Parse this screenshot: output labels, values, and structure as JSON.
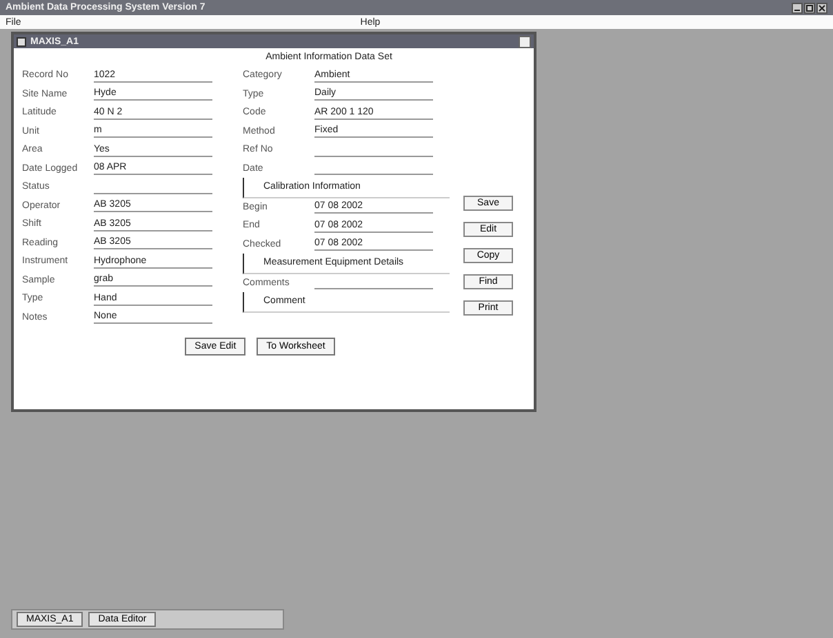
{
  "window": {
    "title": "Ambient Data Processing System Version 7"
  },
  "menu": [
    {
      "label": "File"
    },
    {
      "label": "Help"
    }
  ],
  "form": {
    "title": "MAXIS_A1",
    "heading": "Ambient Information Data Set",
    "left_fields": [
      {
        "label": "Record No",
        "value": "1022"
      },
      {
        "label": "Site Name",
        "value": "Hyde"
      },
      {
        "label": "Latitude",
        "value": "40 N 2"
      },
      {
        "label": "Unit",
        "value": "m"
      },
      {
        "label": "Area",
        "value": "Yes"
      },
      {
        "label": "Date Logged",
        "value": "08 APR"
      },
      {
        "label": "Status"
      },
      {
        "label": "Operator",
        "value": "AB 3205"
      },
      {
        "label": "Shift",
        "value": "AB 3205"
      },
      {
        "label": "Reading",
        "value": "AB 3205"
      },
      {
        "label": "Instrument",
        "value": "Hydrophone"
      },
      {
        "label": "Sample",
        "value": "grab"
      },
      {
        "label": "Type",
        "value": "Hand"
      },
      {
        "label": "Notes",
        "value": "None"
      }
    ],
    "right_fields": [
      {
        "kind": "field",
        "label": "Category",
        "value": "Ambient"
      },
      {
        "kind": "field",
        "label": "Type",
        "value": "Daily"
      },
      {
        "kind": "field",
        "label": "Code",
        "value": "AR 200 1 120"
      },
      {
        "kind": "field",
        "label": "Method",
        "value": "Fixed"
      },
      {
        "kind": "field",
        "label": "Ref No"
      },
      {
        "kind": "field",
        "label": "Date"
      },
      {
        "kind": "section",
        "label": "Calibration Information"
      },
      {
        "kind": "field",
        "label": "Begin",
        "value": "07 08 2002"
      },
      {
        "kind": "field",
        "label": "End",
        "value": "07 08 2002"
      },
      {
        "kind": "field",
        "label": "Checked",
        "value": "07 08 2002"
      },
      {
        "kind": "section",
        "label": "Measurement Equipment Details"
      },
      {
        "kind": "field",
        "label": "Comments"
      },
      {
        "kind": "section",
        "label": "Comment"
      }
    ],
    "side_buttons": [
      "Save",
      "Edit",
      "Copy",
      "Find",
      "Print"
    ],
    "bottom_buttons": [
      "Save Edit",
      "To Worksheet"
    ]
  },
  "taskbar": [
    {
      "label": "MAXIS_A1"
    },
    {
      "label": "Data Editor"
    }
  ]
}
